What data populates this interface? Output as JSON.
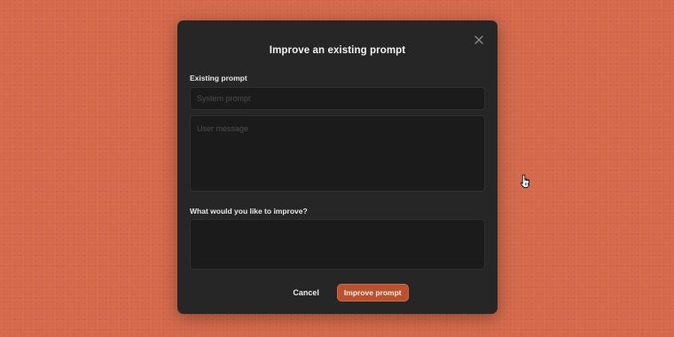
{
  "dialog": {
    "title": "Improve an existing prompt",
    "close_icon": "close-icon"
  },
  "existing_prompt": {
    "label": "Existing prompt",
    "system_placeholder": "System prompt",
    "system_value": "",
    "user_placeholder": "User message",
    "user_value": ""
  },
  "improve": {
    "label": "What would you like to improve?",
    "value": ""
  },
  "actions": {
    "cancel_label": "Cancel",
    "submit_label": "Improve prompt"
  },
  "colors": {
    "background": "#d4694b",
    "modal": "#262626",
    "field": "#1b1b1b",
    "accent": "#b8522f"
  },
  "cursor_icon": "hand-pointer-icon"
}
